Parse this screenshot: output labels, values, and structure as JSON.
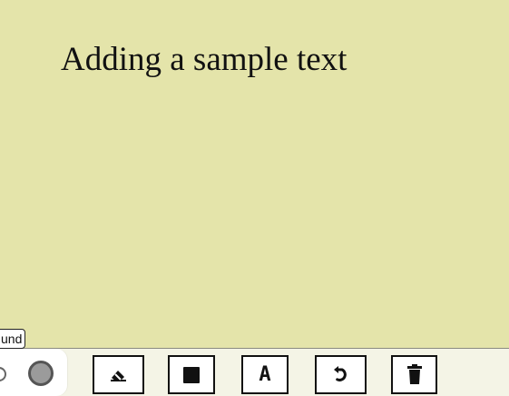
{
  "canvas": {
    "text": "Adding a sample text",
    "background": "#e4e4aa",
    "text_color": "#111111"
  },
  "toolbar": {
    "tooltip": "und",
    "selected_color": "#9b9b9b",
    "buttons": [
      {
        "name": "eraser",
        "icon": "eraser-icon"
      },
      {
        "name": "shape",
        "icon": "square-icon"
      },
      {
        "name": "text",
        "icon": "text-icon",
        "label": "A"
      },
      {
        "name": "undo",
        "icon": "undo-icon"
      },
      {
        "name": "delete",
        "icon": "trash-icon"
      }
    ]
  }
}
